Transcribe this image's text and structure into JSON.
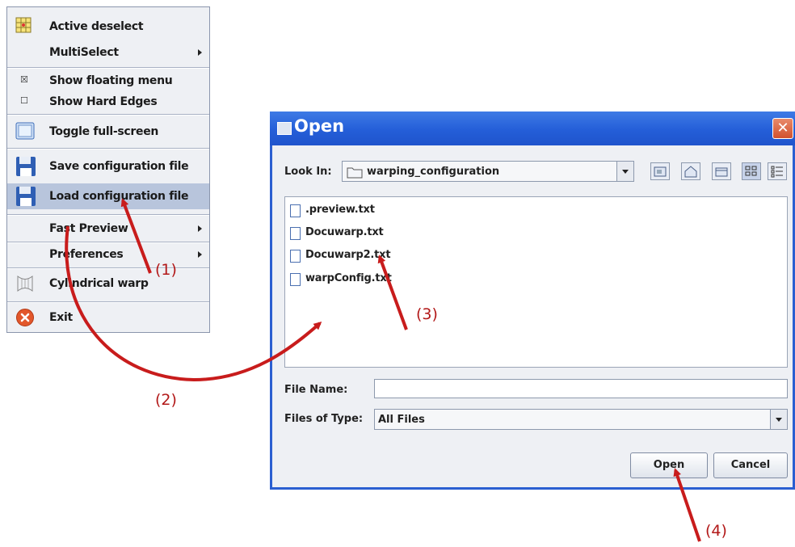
{
  "menu": {
    "items": [
      {
        "label": "Active deselect",
        "icon": "grid-icon"
      },
      {
        "label": "MultiSelect",
        "submenu": true
      },
      {
        "label": "Show floating menu",
        "checked": true
      },
      {
        "label": "Show Hard Edges",
        "checked": false
      },
      {
        "label": "Toggle full-screen",
        "icon": "screen-icon"
      },
      {
        "label": "Save configuration file",
        "icon": "floppy-icon"
      },
      {
        "label": "Load configuration file",
        "icon": "floppy-icon",
        "highlighted": true
      },
      {
        "label": "Fast Preview",
        "submenu": true
      },
      {
        "label": "Preferences",
        "submenu": true
      },
      {
        "label": "Cylindrical warp",
        "icon": "cylinder-icon"
      },
      {
        "label": "Exit",
        "icon": "exit-icon"
      }
    ]
  },
  "dialog": {
    "title": "Open",
    "close_glyph": "✕",
    "look_in_label": "Look In:",
    "look_in_value": "warping_configuration",
    "toolbar": [
      "up-folder-icon",
      "home-icon",
      "new-folder-icon",
      "list-view-icon",
      "details-view-icon"
    ],
    "files": [
      ".preview.txt",
      "Docuwarp.txt",
      "Docuwarp2.txt",
      "warpConfig.txt"
    ],
    "file_name_label": "File Name:",
    "file_name_value": "",
    "files_of_type_label": "Files of Type:",
    "files_of_type_value": "All Files",
    "open_button": "Open",
    "cancel_button": "Cancel"
  },
  "annotations": [
    "(1)",
    "(2)",
    "(3)",
    "(4)"
  ],
  "colors": {
    "accent": "#245ed8",
    "arrow": "#c81c1c",
    "menu_highlight": "#b8c5dc"
  }
}
